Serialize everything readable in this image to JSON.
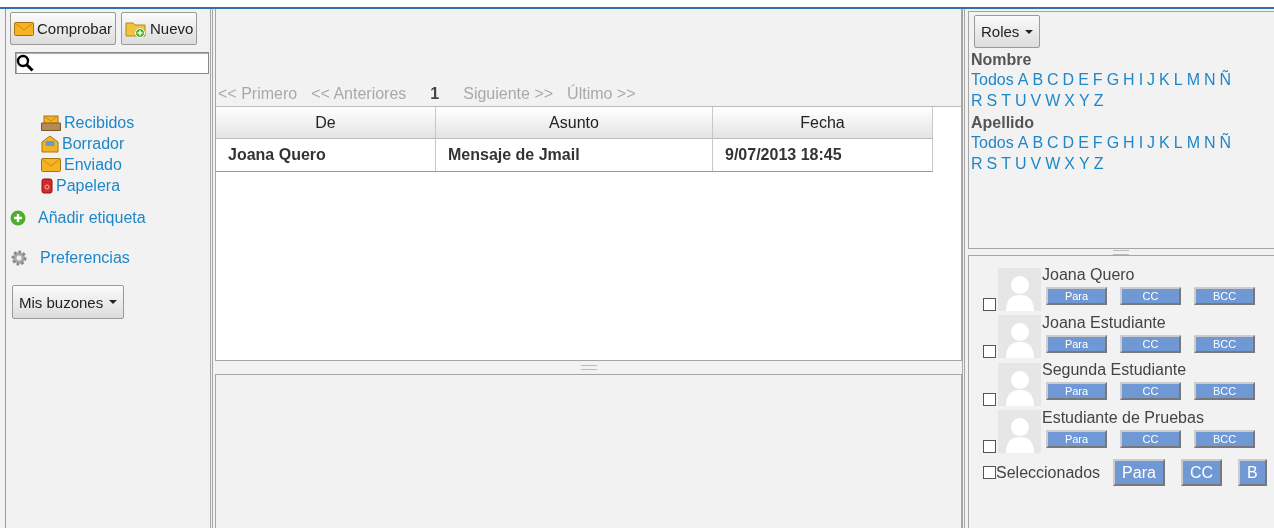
{
  "toolbar": {
    "buttons": [
      {
        "label": "Comprobar",
        "kind": "envelope"
      },
      {
        "label": "Nuevo",
        "kind": "folder-add"
      }
    ]
  },
  "folders": [
    {
      "label": "Recibidos",
      "kind": "inbox"
    },
    {
      "label": "Borrador",
      "kind": "draft"
    },
    {
      "label": "Enviado",
      "kind": "envelope"
    },
    {
      "label": "Papelera",
      "kind": "trash"
    }
  ],
  "actions": [
    {
      "label": "Añadir etiqueta",
      "kind": "add"
    },
    {
      "label": "Preferencias",
      "kind": "gear"
    }
  ],
  "mailbox_menu": {
    "label": "Mis buzones"
  },
  "pager": {
    "first": "<< Primero",
    "prev": "<< Anteriores",
    "current": "1",
    "next": "Siguiente >>",
    "last": "Último >>"
  },
  "table": {
    "columns": [
      "De",
      "Asunto",
      "Fecha"
    ],
    "rows": [
      {
        "cells": [
          "Joana Quero",
          "Mensaje de Jmail",
          "9/07/2013 18:45"
        ],
        "unread": true
      }
    ]
  },
  "roles_menu": {
    "label": "Roles"
  },
  "filters": [
    {
      "heading": "Nombre",
      "lines": [
        [
          "Todos",
          "A",
          "B",
          "C",
          "D",
          "E",
          "F",
          "G",
          "H",
          "I",
          "J",
          "K",
          "L",
          "M",
          "N",
          "Ñ"
        ],
        [
          "R",
          "S",
          "T",
          "U",
          "V",
          "W",
          "X",
          "Y",
          "Z"
        ]
      ]
    },
    {
      "heading": "Apellido",
      "lines": [
        [
          "Todos",
          "A",
          "B",
          "C",
          "D",
          "E",
          "F",
          "G",
          "H",
          "I",
          "J",
          "K",
          "L",
          "M",
          "N",
          "Ñ"
        ],
        [
          "R",
          "S",
          "T",
          "U",
          "V",
          "W",
          "X",
          "Y",
          "Z"
        ]
      ]
    }
  ],
  "contacts": [
    {
      "name": "Joana Quero",
      "checked": false,
      "buttons": [
        "Para",
        "CC",
        "BCC"
      ]
    },
    {
      "name": "Joana Estudiante",
      "checked": false,
      "buttons": [
        "Para",
        "CC",
        "BCC"
      ]
    },
    {
      "name": "Segunda Estudiante",
      "checked": false,
      "buttons": [
        "Para",
        "CC",
        "BCC"
      ]
    },
    {
      "name": "Estudiante de Pruebas",
      "checked": false,
      "buttons": [
        "Para",
        "CC",
        "BCC"
      ]
    }
  ],
  "selected_bar": {
    "label": "Seleccionados",
    "checked": false,
    "buttons": [
      "Para",
      "CC",
      "B"
    ]
  }
}
